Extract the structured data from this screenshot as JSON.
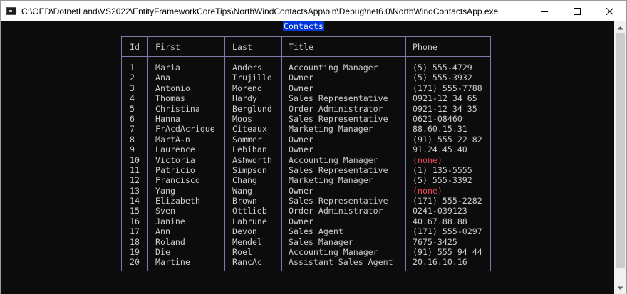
{
  "window": {
    "title": "C:\\OED\\DotnetLand\\VS2022\\EntityFrameworkCoreTips\\NorthWindContactsApp\\bin\\Debug\\net6.0\\NorthWindContactsApp.exe"
  },
  "console": {
    "heading": "Contacts",
    "columns": [
      "Id",
      "First",
      "Last",
      "Title",
      "Phone"
    ],
    "rows": [
      [
        "1",
        "Maria",
        "Anders",
        "Accounting Manager",
        "(5) 555-4729"
      ],
      [
        "2",
        "Ana",
        "Trujillo",
        "Owner",
        "(5) 555-3932"
      ],
      [
        "3",
        "Antonio",
        "Moreno",
        "Owner",
        "(171) 555-7788"
      ],
      [
        "4",
        "Thomas",
        "Hardy",
        "Sales Representative",
        "0921-12 34 65"
      ],
      [
        "5",
        "Christina",
        "Berglund",
        "Order Administrator",
        "0921-12 34 35"
      ],
      [
        "6",
        "Hanna",
        "Moos",
        "Sales Representative",
        "0621-08460"
      ],
      [
        "7",
        "FrAcdAcrique",
        "Citeaux",
        "Marketing Manager",
        "88.60.15.31"
      ],
      [
        "8",
        "MartA-n",
        "Sommer",
        "Owner",
        "(91) 555 22 82"
      ],
      [
        "9",
        "Laurence",
        "Lebihan",
        "Owner",
        "91.24.45.40"
      ],
      [
        "10",
        "Victoria",
        "Ashworth",
        "Accounting Manager",
        "(none)"
      ],
      [
        "11",
        "Patricio",
        "Simpson",
        "Sales Representative",
        "(1) 135-5555"
      ],
      [
        "12",
        "Francisco",
        "Chang",
        "Marketing Manager",
        "(5) 555-3392"
      ],
      [
        "13",
        "Yang",
        "Wang",
        "Owner",
        "(none)"
      ],
      [
        "14",
        "Elizabeth",
        "Brown",
        "Sales Representative",
        "(171) 555-2282"
      ],
      [
        "15",
        "Sven",
        "Ottlieb",
        "Order Administrator",
        "0241-039123"
      ],
      [
        "16",
        "Janine",
        "Labrune",
        "Owner",
        "40.67.88.88"
      ],
      [
        "17",
        "Ann",
        "Devon",
        "Sales Agent",
        "(171) 555-0297"
      ],
      [
        "18",
        "Roland",
        "Mendel",
        "Sales Manager",
        "7675-3425"
      ],
      [
        "19",
        "Die",
        "Roel",
        "Accounting Manager",
        "(91) 555 94 44"
      ],
      [
        "20",
        "Martine",
        "RancAc",
        "Assistant Sales Agent",
        "20.16.10.16"
      ]
    ]
  },
  "colors": {
    "console_bg": "#0c0c0c",
    "console_text": "#cccccc",
    "heading_bg": "#0037da",
    "border": "#7b7ba8",
    "none_text": "#e74856"
  },
  "icons": {
    "app": "console-app-icon",
    "minimize": "minimize-icon",
    "maximize": "maximize-icon",
    "close": "close-icon"
  }
}
